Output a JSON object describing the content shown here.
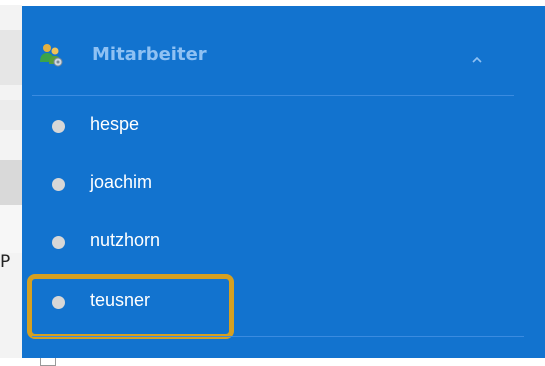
{
  "background": {
    "letter": "P"
  },
  "panel": {
    "colors": {
      "panel": "#1273cf",
      "header_text": "#8fc1f3",
      "item_text": "#ffffff",
      "highlight": "#d5a021"
    },
    "header": {
      "title": "Mitarbeiter",
      "icon": "users-group-icon",
      "chevron": "chevron-up-icon"
    },
    "items": [
      {
        "label": "hespe"
      },
      {
        "label": "joachim"
      },
      {
        "label": "nutzhorn"
      },
      {
        "label": "teusner",
        "highlighted": true
      }
    ]
  }
}
